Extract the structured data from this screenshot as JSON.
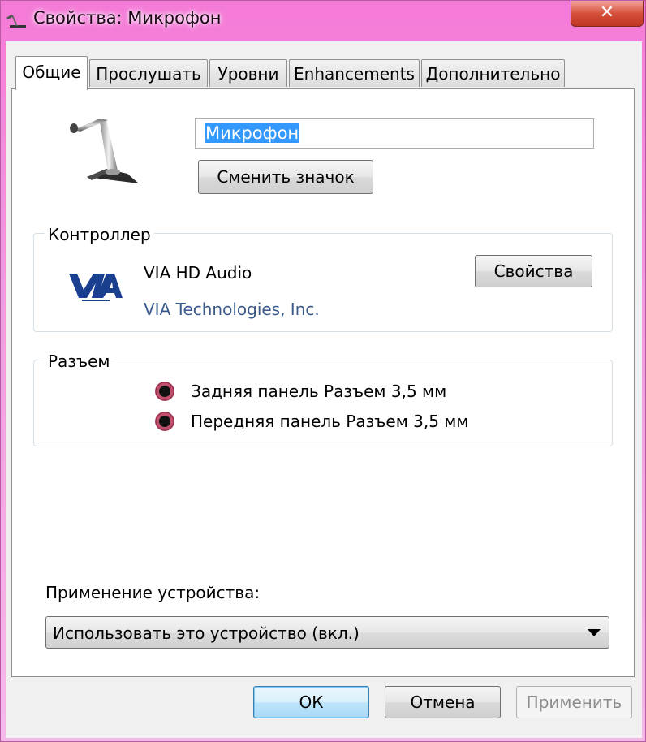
{
  "window": {
    "title": "Свойства: Микрофон",
    "close_symbol": "✕"
  },
  "tabs": [
    {
      "label": "Общие",
      "active": true
    },
    {
      "label": "Прослушать",
      "active": false
    },
    {
      "label": "Уровни",
      "active": false
    },
    {
      "label": "Enhancements",
      "active": false
    },
    {
      "label": "Дополнительно",
      "active": false
    }
  ],
  "general": {
    "device_name": "Микрофон",
    "change_icon_label": "Сменить значок",
    "icon": "microphone-icon"
  },
  "controller": {
    "group_label": "Контроллер",
    "logo": "via-logo-icon",
    "name": "VIA HD Audio",
    "vendor": "VIA Technologies, Inc.",
    "properties_label": "Свойства"
  },
  "jack": {
    "group_label": "Разъем",
    "items": [
      {
        "label": "Задняя панель Разъем 3,5 мм",
        "color": "#c0506e"
      },
      {
        "label": "Передняя панель Разъем 3,5 мм",
        "color": "#c0506e"
      }
    ]
  },
  "device_usage": {
    "label": "Применение устройства:",
    "selected": "Использовать это устройство (вкл.)"
  },
  "footer": {
    "ok_label": "ОК",
    "cancel_label": "Отмена",
    "apply_label": "Применить"
  }
}
